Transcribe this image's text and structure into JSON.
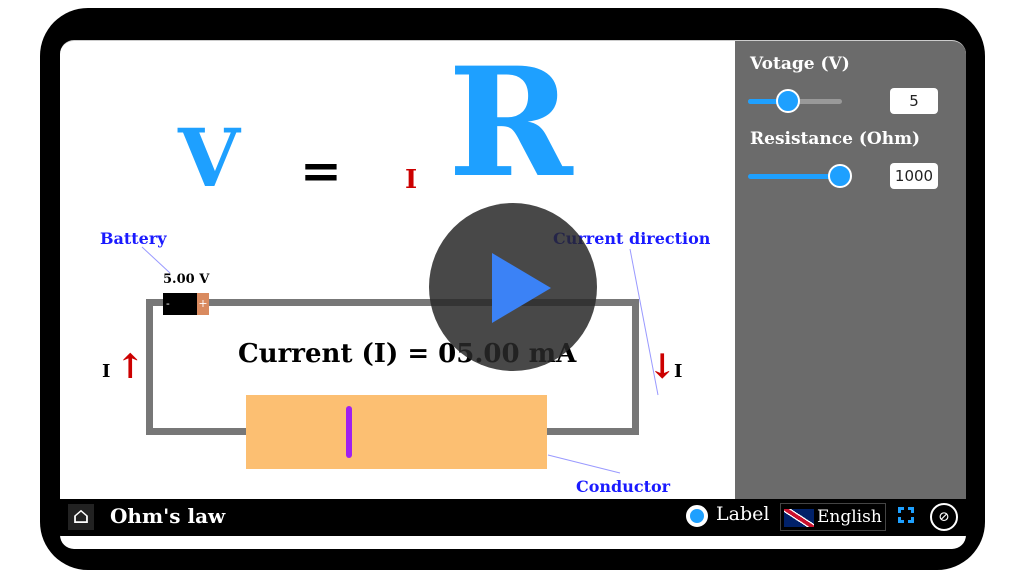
{
  "equation": {
    "v": "V",
    "eq": "=",
    "i": "I",
    "r": "R"
  },
  "colors": {
    "accent": "#1ea0ff",
    "arrow": "#cc0000",
    "conductor": "#fcbf72",
    "label": "#1a1aff"
  },
  "panel": {
    "voltage_label": "Votage (V)",
    "voltage_value": "5",
    "voltage_fraction": 0.4,
    "resistance_label": "Resistance (Ohm)",
    "resistance_value": "1000",
    "resistance_fraction": 0.9
  },
  "circuit": {
    "battery_label": "Battery",
    "battery_voltage": "5.00 V",
    "battery_minus": "-",
    "battery_plus": "+",
    "current_text": "Current (I) = 05.00 mA",
    "current_direction_label": "Current direction",
    "conductor_label": "Conductor",
    "i_left": "I",
    "i_right": "I"
  },
  "bottom_bar": {
    "title": "Ohm's law",
    "label_toggle": "Label",
    "language": "English",
    "icons": [
      "home-icon",
      "radio-icon",
      "uk-flag-icon",
      "fullscreen-icon",
      "hide-icon"
    ]
  },
  "overlay": {
    "icon": "play-icon"
  }
}
